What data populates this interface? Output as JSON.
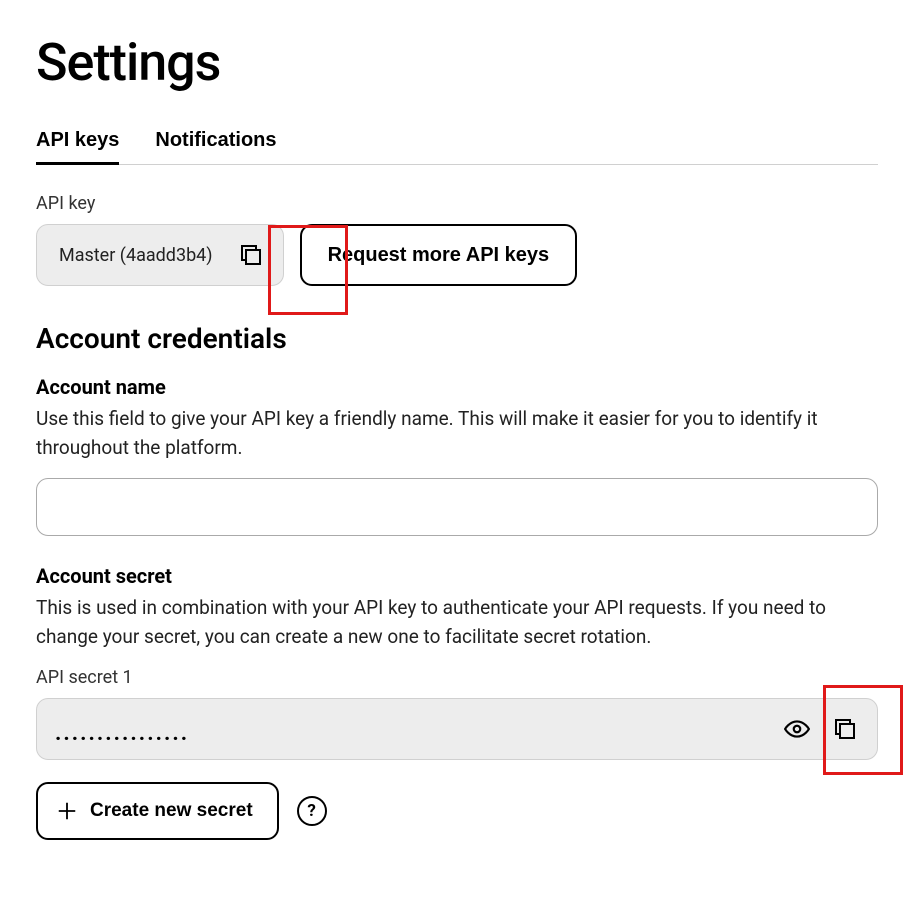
{
  "page_title": "Settings",
  "tabs": {
    "api_keys": "API keys",
    "notifications": "Notifications"
  },
  "api_key_section": {
    "label": "API key",
    "selected_key": "Master (4aadd3b4)",
    "request_more_label": "Request more API keys"
  },
  "credentials": {
    "heading": "Account credentials",
    "account_name": {
      "label": "Account name",
      "description": "Use this field to give your API key a friendly name. This will make it easier for you to identify it throughout the platform.",
      "value": ""
    },
    "account_secret": {
      "label": "Account secret",
      "description": "This is used in combination with your API key to authenticate your API requests. If you need to change your secret, you can create a new one to facilitate secret rotation.",
      "secret_label": "API secret 1",
      "masked_value": "................"
    },
    "create_secret_label": "Create new secret",
    "help_label": "?"
  }
}
